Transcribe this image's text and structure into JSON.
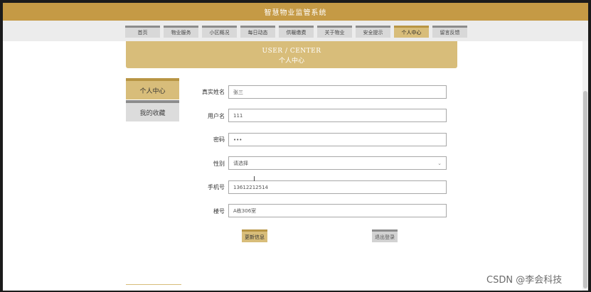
{
  "header": {
    "title": "智慧物业监管系统"
  },
  "nav": {
    "items": [
      "首页",
      "物业服务",
      "小区概况",
      "每日动态",
      "供暖缴费",
      "关于物业",
      "安全提示",
      "个人中心",
      "留言反馈"
    ],
    "active": "个人中心"
  },
  "banner": {
    "en": "USER / CENTER",
    "cn": "个人中心"
  },
  "sidebar": {
    "items": [
      {
        "label": "个人中心"
      },
      {
        "label": "我的收藏"
      }
    ]
  },
  "form": {
    "fields": [
      {
        "label": "真实姓名",
        "value": "张三"
      },
      {
        "label": "用户名",
        "value": "111"
      },
      {
        "label": "密码",
        "value": "•••"
      },
      {
        "label": "性别",
        "value": "请选择"
      },
      {
        "label": "手机号",
        "value": "13612212514"
      },
      {
        "label": "楼号",
        "value": "A栋306室"
      }
    ]
  },
  "buttons": {
    "update": "更新信息",
    "logout": "退出登录"
  },
  "watermark": "CSDN @李会科技"
}
